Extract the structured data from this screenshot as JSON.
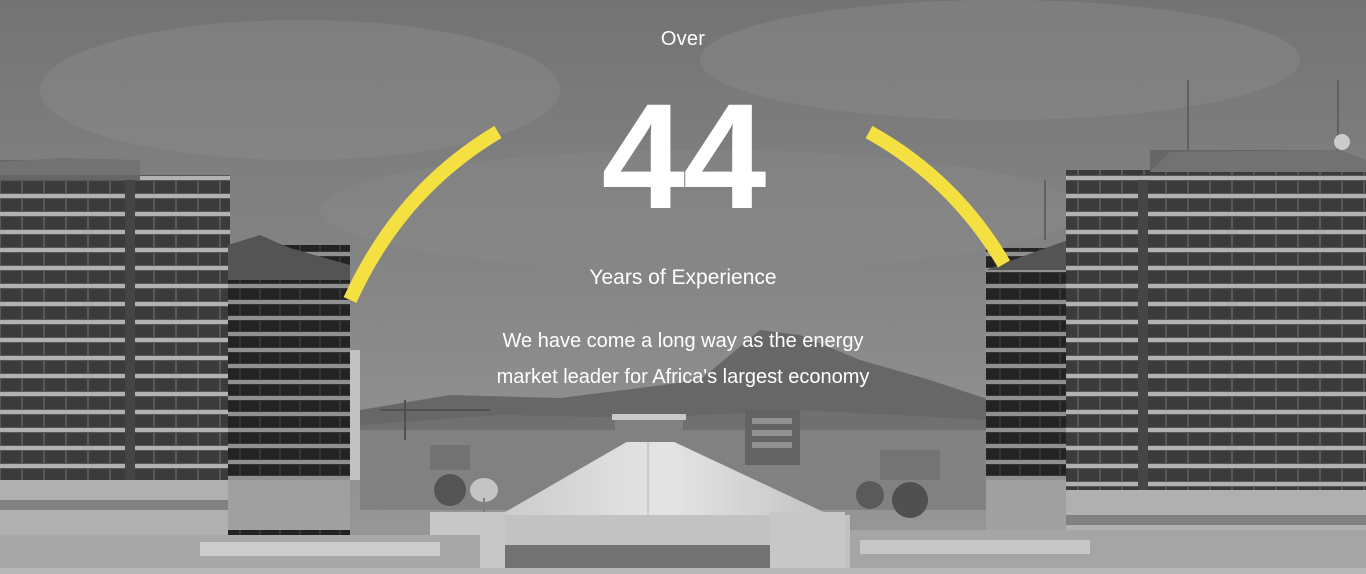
{
  "stat": {
    "prefix": "Over",
    "value": "44",
    "caption": "Years of Experience",
    "description": "We have come a long way as the energy market leader for Africa's largest economy"
  },
  "colors": {
    "accent": "#f4e041",
    "text": "#ffffff"
  },
  "icons": {
    "arc": "yellow-arc-decoration"
  }
}
